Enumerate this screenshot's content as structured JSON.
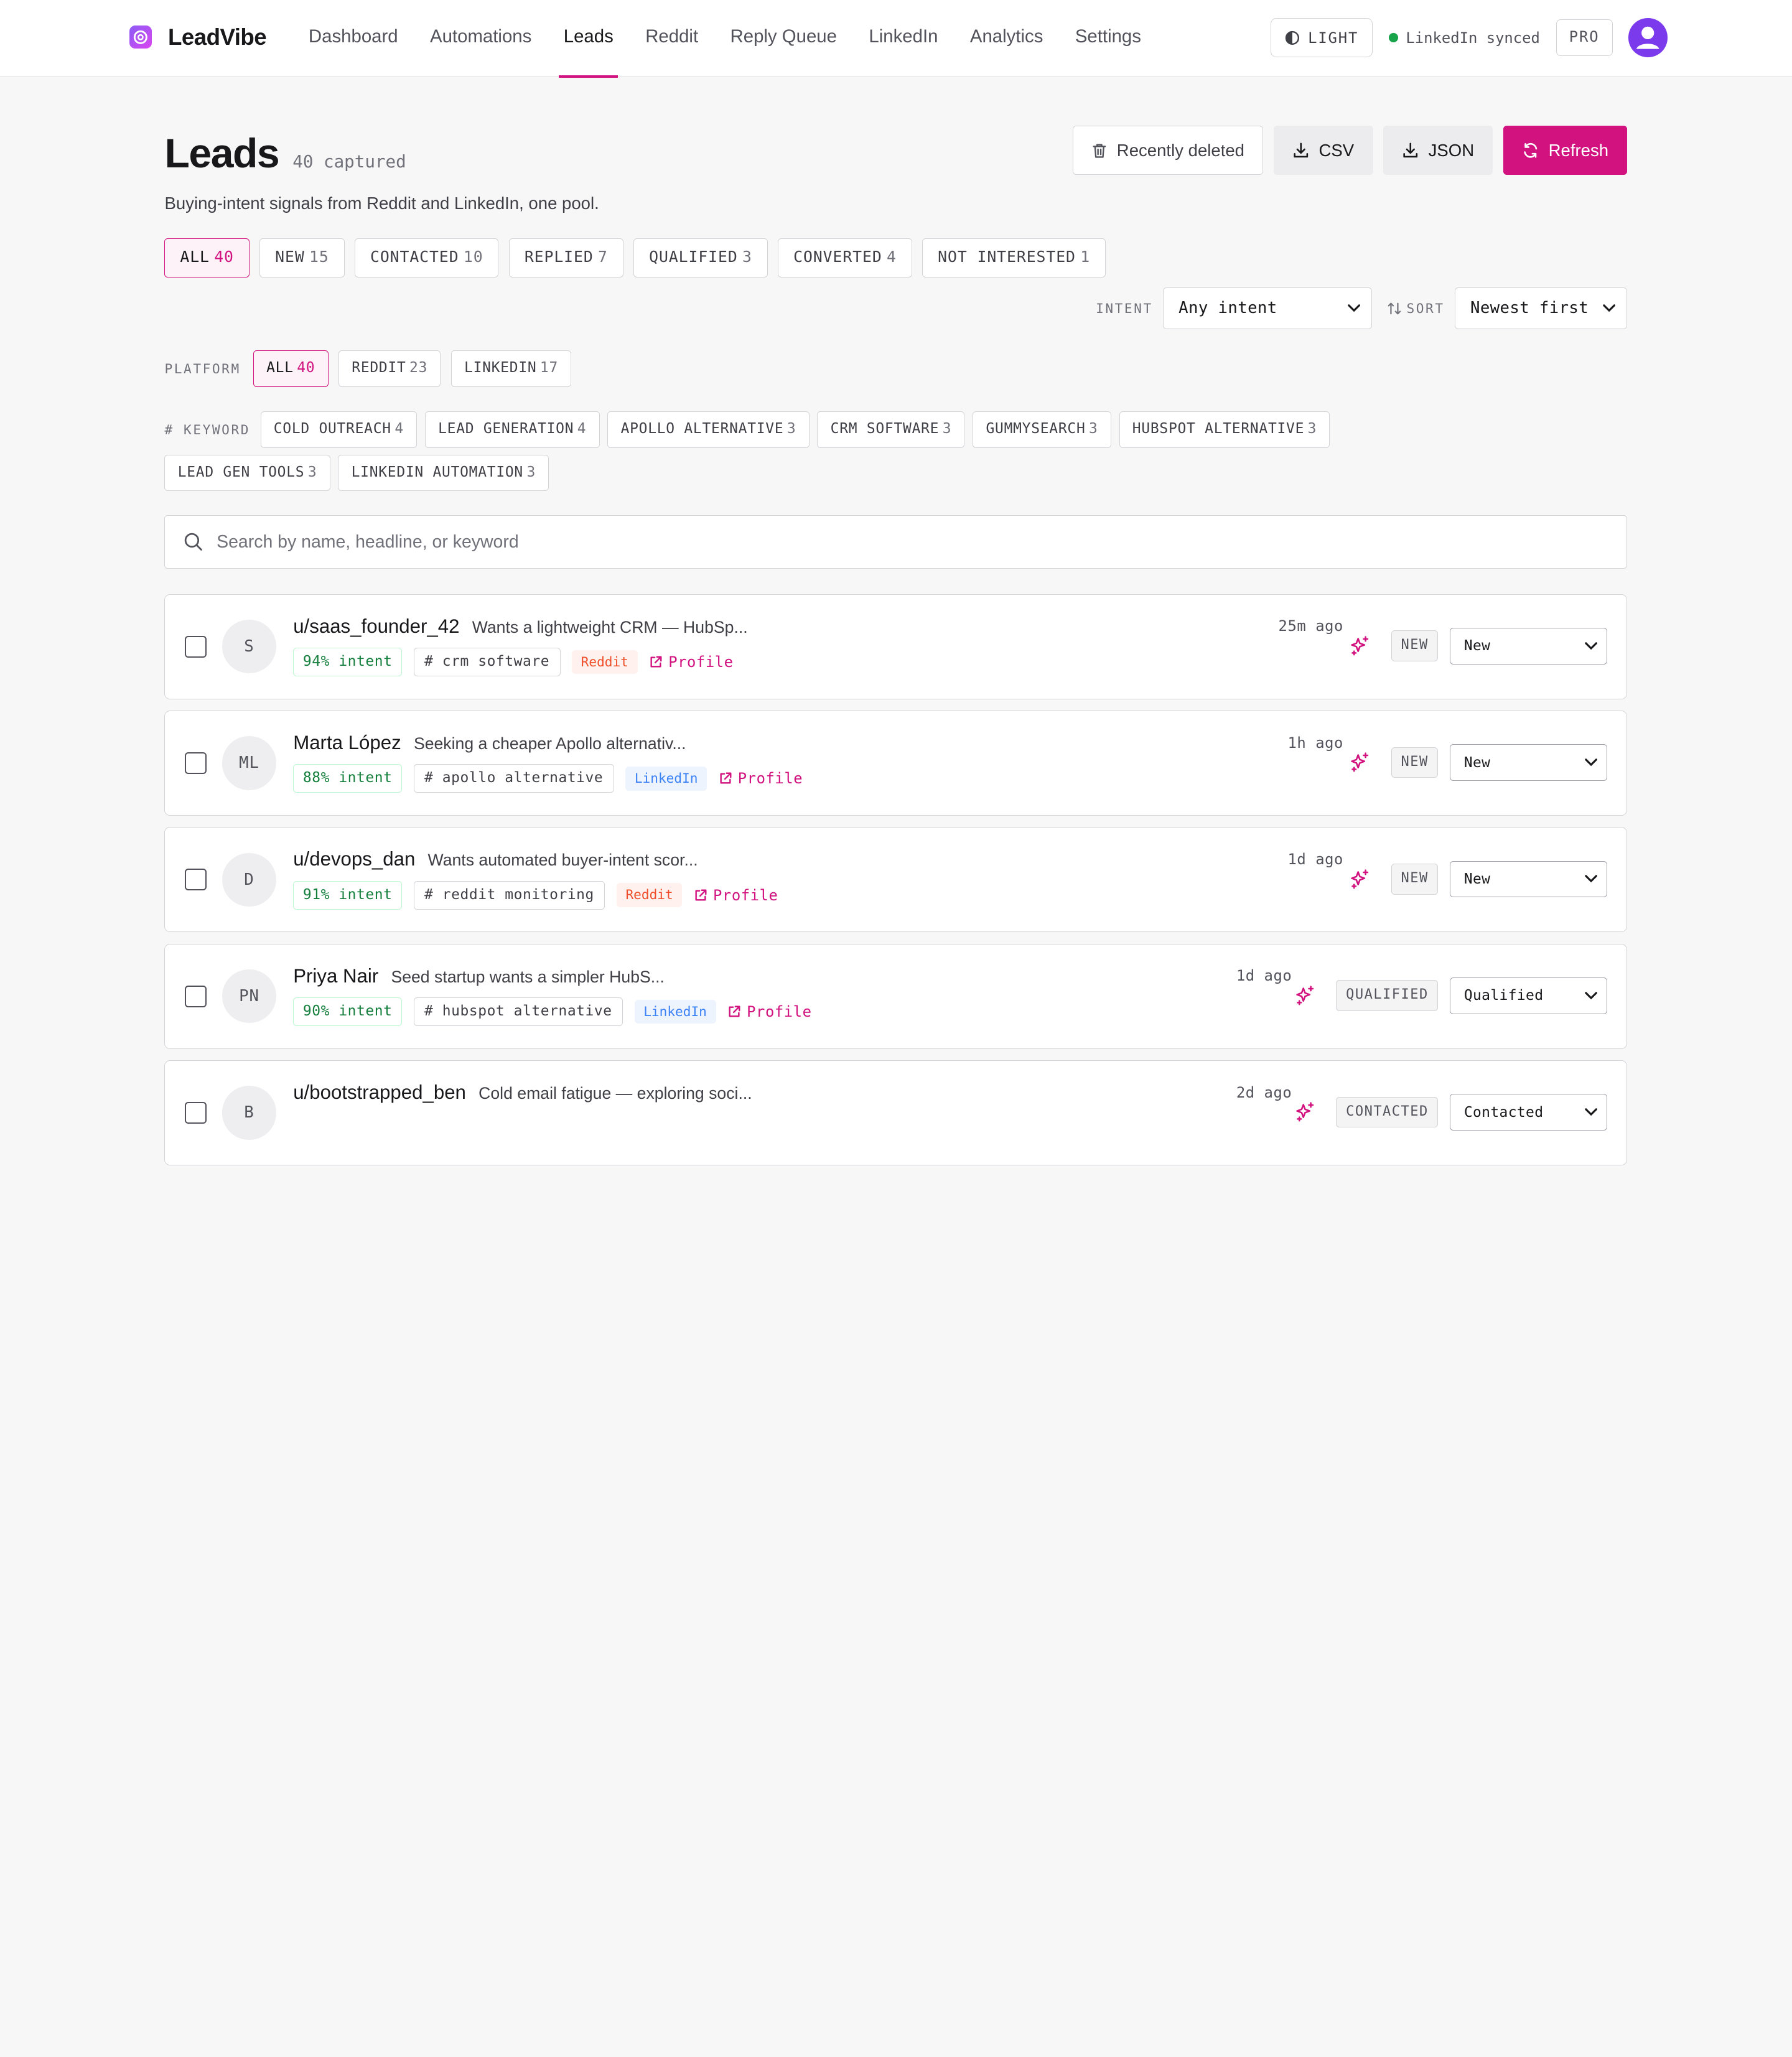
{
  "brand": {
    "name": "LeadVibe"
  },
  "nav": {
    "items": [
      {
        "label": "Dashboard"
      },
      {
        "label": "Automations"
      },
      {
        "label": "Leads",
        "active": true
      },
      {
        "label": "Reddit"
      },
      {
        "label": "Reply Queue"
      },
      {
        "label": "LinkedIn"
      },
      {
        "label": "Analytics"
      },
      {
        "label": "Settings"
      }
    ]
  },
  "topbar": {
    "theme_label": "LIGHT",
    "sync_label": "LinkedIn synced",
    "plan_label": "PRO"
  },
  "page": {
    "title": "Leads",
    "captured": "40 captured",
    "subtitle": "Buying-intent signals from Reddit and LinkedIn, one pool."
  },
  "actions": {
    "recently_deleted": "Recently deleted",
    "csv": "CSV",
    "json": "JSON",
    "refresh": "Refresh"
  },
  "status_filters": [
    {
      "label": "ALL",
      "count": "40",
      "active": true
    },
    {
      "label": "NEW",
      "count": "15"
    },
    {
      "label": "CONTACTED",
      "count": "10"
    },
    {
      "label": "REPLIED",
      "count": "7"
    },
    {
      "label": "QUALIFIED",
      "count": "3"
    },
    {
      "label": "CONVERTED",
      "count": "4"
    },
    {
      "label": "NOT INTERESTED",
      "count": "1"
    }
  ],
  "filters": {
    "intent_label": "INTENT",
    "intent_value": "Any intent",
    "sort_label": "SORT",
    "sort_value": "Newest first"
  },
  "platform": {
    "label": "PLATFORM",
    "chips": [
      {
        "label": "ALL",
        "count": "40",
        "active": true
      },
      {
        "label": "REDDIT",
        "count": "23"
      },
      {
        "label": "LINKEDIN",
        "count": "17"
      }
    ]
  },
  "keywords": {
    "label": "# KEYWORD",
    "chips": [
      {
        "label": "COLD OUTREACH",
        "count": "4"
      },
      {
        "label": "LEAD GENERATION",
        "count": "4"
      },
      {
        "label": "APOLLO ALTERNATIVE",
        "count": "3"
      },
      {
        "label": "CRM SOFTWARE",
        "count": "3"
      },
      {
        "label": "GUMMYSEARCH",
        "count": "3"
      },
      {
        "label": "HUBSPOT ALTERNATIVE",
        "count": "3"
      },
      {
        "label": "LEAD GEN TOOLS",
        "count": "3"
      },
      {
        "label": "LINKEDIN AUTOMATION",
        "count": "3"
      }
    ]
  },
  "search": {
    "placeholder": "Search by name, headline, or keyword"
  },
  "leads": [
    {
      "initials": "S",
      "name": "u/saas_founder_42",
      "headline": "Wants a lightweight CRM — HubSp...",
      "intent": "94% intent",
      "keyword": "# crm software",
      "platform": "Reddit",
      "platform_key": "reddit",
      "profile": "Profile",
      "time": "25m ago",
      "status_tag": "NEW",
      "status_value": "New"
    },
    {
      "initials": "ML",
      "name": "Marta López",
      "headline": "Seeking a cheaper Apollo alternativ...",
      "intent": "88% intent",
      "keyword": "# apollo alternative",
      "platform": "LinkedIn",
      "platform_key": "linkedin",
      "profile": "Profile",
      "time": "1h ago",
      "status_tag": "NEW",
      "status_value": "New"
    },
    {
      "initials": "D",
      "name": "u/devops_dan",
      "headline": "Wants automated buyer-intent scor...",
      "intent": "91% intent",
      "keyword": "# reddit monitoring",
      "platform": "Reddit",
      "platform_key": "reddit",
      "profile": "Profile",
      "time": "1d ago",
      "status_tag": "NEW",
      "status_value": "New"
    },
    {
      "initials": "PN",
      "name": "Priya Nair",
      "headline": "Seed startup wants a simpler HubS...",
      "intent": "90% intent",
      "keyword": "# hubspot alternative",
      "platform": "LinkedIn",
      "platform_key": "linkedin",
      "profile": "Profile",
      "time": "1d ago",
      "status_tag": "QUALIFIED",
      "status_value": "Qualified"
    },
    {
      "initials": "B",
      "name": "u/bootstrapped_ben",
      "headline": "Cold email fatigue — exploring soci...",
      "intent": "",
      "keyword": "",
      "platform": "",
      "platform_key": "reddit",
      "profile": "",
      "time": "2d ago",
      "status_tag": "CONTACTED",
      "status_value": "Contacted"
    }
  ],
  "colors": {
    "accent": "#d1127f",
    "reddit": "#ef4e2b",
    "linkedin": "#3b82f6",
    "intent": "#15803d"
  }
}
